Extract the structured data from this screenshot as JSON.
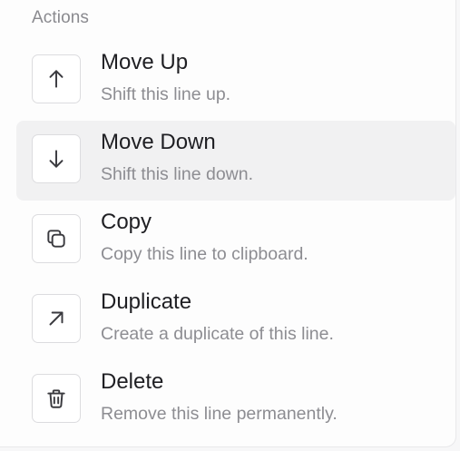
{
  "section": {
    "title": "Actions"
  },
  "items": [
    {
      "title": "Move Up",
      "description": "Shift this line up.",
      "icon": "arrow-up-icon",
      "active": false
    },
    {
      "title": "Move Down",
      "description": "Shift this line down.",
      "icon": "arrow-down-icon",
      "active": true
    },
    {
      "title": "Copy",
      "description": "Copy this line to clipboard.",
      "icon": "copy-icon",
      "active": false
    },
    {
      "title": "Duplicate",
      "description": "Create a duplicate of this line.",
      "icon": "arrow-up-right-icon",
      "active": false
    },
    {
      "title": "Delete",
      "description": "Remove this line permanently.",
      "icon": "trash-icon",
      "active": false
    }
  ],
  "colors": {
    "active_background": "#f1f1f2",
    "title_text": "#1f1f23",
    "description_text": "#8d8d92",
    "section_text": "#8a8a8f",
    "icon_stroke": "#3a3a3f"
  }
}
